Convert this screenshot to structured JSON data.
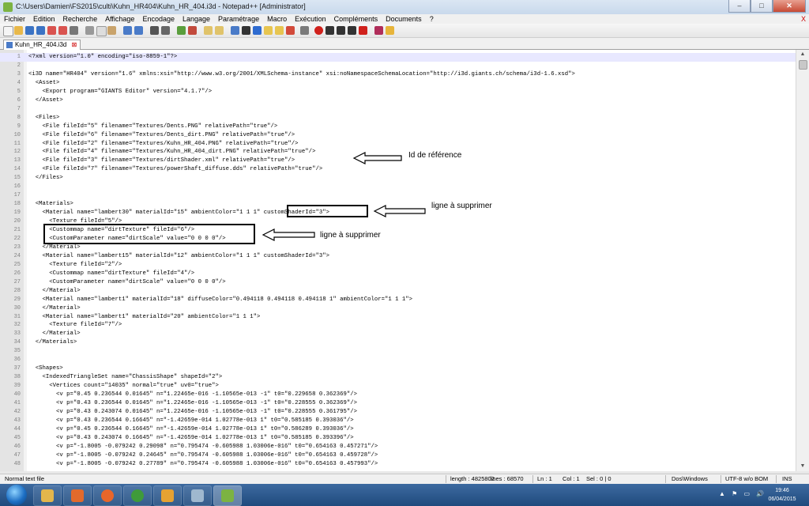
{
  "window": {
    "title": "C:\\Users\\Damien\\FS2015\\culti\\Kuhn_HR404\\Kuhn_HR_404.i3d - Notepad++ [Administrator]",
    "minimize_glyph": "–",
    "maximize_glyph": "□",
    "close_glyph": "✕"
  },
  "menu": {
    "items": [
      "Fichier",
      "Edition",
      "Recherche",
      "Affichage",
      "Encodage",
      "Langage",
      "Paramétrage",
      "Macro",
      "Exécution",
      "Compléments",
      "Documents",
      "?"
    ],
    "close_glyph": "X"
  },
  "tab": {
    "label": "Kuhn_HR_404.i3d",
    "close_glyph": "⊠"
  },
  "editor": {
    "lines": [
      {
        "n": "1",
        "text": "<?xml version=\"1.0\" encoding=\"iso-8859-1\"?>"
      },
      {
        "n": "2",
        "text": ""
      },
      {
        "n": "3",
        "text": "<i3D name=\"HR404\" version=\"1.6\" xmlns:xsi=\"http://www.w3.org/2001/XMLSchema-instance\" xsi:noNamespaceSchemaLocation=\"http://i3d.giants.ch/schema/i3d-1.6.xsd\">"
      },
      {
        "n": "4",
        "text": "  <Asset>"
      },
      {
        "n": "5",
        "text": "    <Export program=\"GIANTS Editor\" version=\"4.1.7\"/>"
      },
      {
        "n": "6",
        "text": "  </Asset>"
      },
      {
        "n": "7",
        "text": ""
      },
      {
        "n": "8",
        "text": "  <Files>"
      },
      {
        "n": "9",
        "text": "    <File fileId=\"5\" filename=\"Textures/Dents.PNG\" relativePath=\"true\"/>"
      },
      {
        "n": "10",
        "text": "    <File fileId=\"6\" filename=\"Textures/Dents_dirt.PNG\" relativePath=\"true\"/>"
      },
      {
        "n": "11",
        "text": "    <File fileId=\"2\" filename=\"Textures/Kuhn_HR_404.PNG\" relativePath=\"true\"/>"
      },
      {
        "n": "12",
        "text": "    <File fileId=\"4\" filename=\"Textures/Kuhn_HR_404_dirt.PNG\" relativePath=\"true\"/>"
      },
      {
        "n": "13",
        "text": "    <File fileId=\"3\" filename=\"Textures/dirtShader.xml\" relativePath=\"true\"/>"
      },
      {
        "n": "14",
        "text": "    <File fileId=\"7\" filename=\"Textures/powerShaft_diffuse.dds\" relativePath=\"true\"/>"
      },
      {
        "n": "15",
        "text": "  </Files>"
      },
      {
        "n": "16",
        "text": ""
      },
      {
        "n": "17",
        "text": ""
      },
      {
        "n": "18",
        "text": "  <Materials>"
      },
      {
        "n": "19",
        "text": "    <Material name=\"lambert30\" materialId=\"15\" ambientColor=\"1 1 1\" customShaderId=\"3\">"
      },
      {
        "n": "20",
        "text": "      <Texture fileId=\"5\"/>"
      },
      {
        "n": "21",
        "text": "      <Custommap name=\"dirtTexture\" fileId=\"6\"/>"
      },
      {
        "n": "22",
        "text": "      <CustomParameter name=\"dirtScale\" value=\"0 0 0 0\"/>"
      },
      {
        "n": "23",
        "text": "    </Material>"
      },
      {
        "n": "24",
        "text": "    <Material name=\"lambert15\" materialId=\"12\" ambientColor=\"1 1 1\" customShaderId=\"3\">"
      },
      {
        "n": "25",
        "text": "      <Texture fileId=\"2\"/>"
      },
      {
        "n": "26",
        "text": "      <Custommap name=\"dirtTexture\" fileId=\"4\"/>"
      },
      {
        "n": "27",
        "text": "      <CustomParameter name=\"dirtScale\" value=\"0 0 0 0\"/>"
      },
      {
        "n": "28",
        "text": "    </Material>"
      },
      {
        "n": "29",
        "text": "    <Material name=\"lambert1\" materialId=\"18\" diffuseColor=\"0.494118 0.494118 0.494118 1\" ambientColor=\"1 1 1\">"
      },
      {
        "n": "30",
        "text": "    </Material>"
      },
      {
        "n": "31",
        "text": "    <Material name=\"lambert1\" materialId=\"20\" ambientColor=\"1 1 1\">"
      },
      {
        "n": "32",
        "text": "      <Texture fileId=\"7\"/>"
      },
      {
        "n": "33",
        "text": "    </Material>"
      },
      {
        "n": "34",
        "text": "  </Materials>"
      },
      {
        "n": "35",
        "text": ""
      },
      {
        "n": "36",
        "text": ""
      },
      {
        "n": "37",
        "text": "  <Shapes>"
      },
      {
        "n": "38",
        "text": "    <IndexedTriangleSet name=\"ChassisShape\" shapeId=\"2\">"
      },
      {
        "n": "39",
        "text": "      <Vertices count=\"14035\" normal=\"true\" uv0=\"true\">"
      },
      {
        "n": "40",
        "text": "        <v p=\"0.45 0.236544 0.01645\" n=\"1.22465e-016 -1.10565e-013 -1\" t0=\"0.229658 0.362369\"/>"
      },
      {
        "n": "41",
        "text": "        <v p=\"0.43 0.236544 0.01645\" n=\"1.22465e-016 -1.10565e-013 -1\" t0=\"0.228555 0.362369\"/>"
      },
      {
        "n": "42",
        "text": "        <v p=\"0.43 0.243074 0.01645\" n=\"1.22465e-016 -1.10565e-013 -1\" t0=\"0.228555 0.361795\"/>"
      },
      {
        "n": "43",
        "text": "        <v p=\"0.43 0.236544 0.16645\" n=\"-1.42659e-014 1.02778e-013 1\" t0=\"0.585185 0.393036\"/>"
      },
      {
        "n": "44",
        "text": "        <v p=\"0.45 0.236544 0.16645\" n=\"-1.42659e-014 1.02778e-013 1\" t0=\"0.586289 0.393036\"/>"
      },
      {
        "n": "45",
        "text": "        <v p=\"0.43 0.243074 0.16645\" n=\"-1.42659e-014 1.02778e-013 1\" t0=\"0.585185 0.393396\"/>"
      },
      {
        "n": "46",
        "text": "        <v p=\"-1.8005 -0.079242 0.29098\" n=\"0.795474 -0.605988 1.03006e-016\" t0=\"0.654163 0.457271\"/>"
      },
      {
        "n": "47",
        "text": "        <v p=\"-1.8005 -0.079242 0.24645\" n=\"0.795474 -0.605988 1.03006e-016\" t0=\"0.654163 0.459728\"/>"
      },
      {
        "n": "48",
        "text": "        <v p=\"-1.8005 -0.079242 0.27789\" n=\"0.795474 -0.605988 1.03006e-016\" t0=\"0.654163 0.457993\"/>"
      }
    ]
  },
  "annotations": {
    "id_reference": "Id de référence",
    "delete_line_1": "ligne à supprimer",
    "delete_line_2": "ligne à supprimer"
  },
  "status": {
    "file_type": "Normal text file",
    "length": "length : 4825802",
    "lines": "lines : 68570",
    "ln": "Ln : 1",
    "col": "Col : 1",
    "sel": "Sel : 0 | 0",
    "eol": "Dos\\Windows",
    "encoding": "UTF-8 w/o BOM",
    "mode": "INS"
  },
  "taskbar": {
    "apps": [
      "explorer-icon",
      "media-player-icon",
      "firefox-icon",
      "utorrent-icon",
      "sublime-icon",
      "tool-icon",
      "notepadpp-icon"
    ],
    "time": "19:46",
    "date": "06/04/2015",
    "tray_glyphs": "▲ ⚑ ▭ 🔊"
  },
  "colors": {
    "line_number_bg": "#e4e4e4",
    "current_line": "#e8e8ff",
    "taskbar": "#2a5a91"
  }
}
